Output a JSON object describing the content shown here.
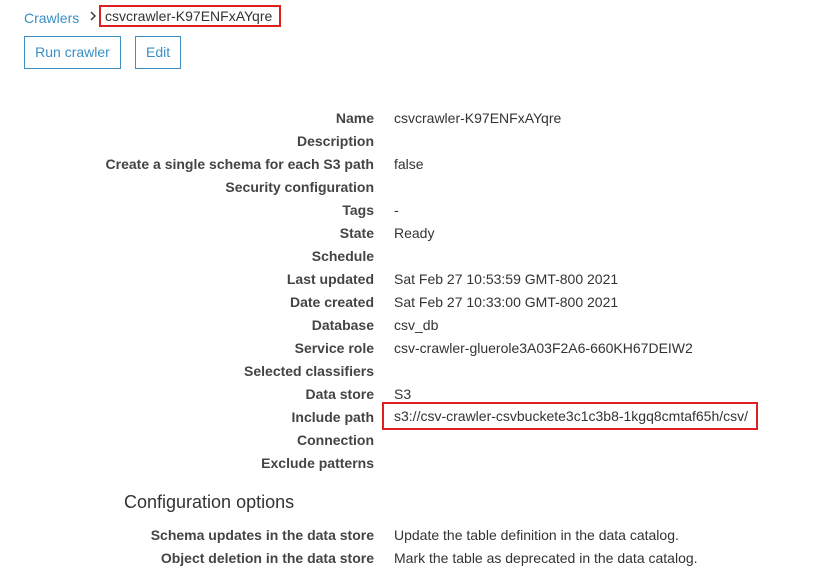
{
  "breadcrumb": {
    "parent": "Crawlers",
    "current": "csvcrawler-K97ENFxAYqre"
  },
  "actions": {
    "run_label": "Run crawler",
    "edit_label": "Edit"
  },
  "details": [
    {
      "label": "Name",
      "value": "csvcrawler-K97ENFxAYqre"
    },
    {
      "label": "Description",
      "value": ""
    },
    {
      "label": "Create a single schema for each S3 path",
      "value": "false"
    },
    {
      "label": "Security configuration",
      "value": ""
    },
    {
      "label": "Tags",
      "value": "-"
    },
    {
      "label": "State",
      "value": "Ready"
    },
    {
      "label": "Schedule",
      "value": ""
    },
    {
      "label": "Last updated",
      "value": "Sat Feb 27 10:53:59 GMT-800 2021"
    },
    {
      "label": "Date created",
      "value": "Sat Feb 27 10:33:00 GMT-800 2021"
    },
    {
      "label": "Database",
      "value": "csv_db"
    },
    {
      "label": "Service role",
      "value": "csv-crawler-gluerole3A03F2A6-660KH67DEIW2"
    },
    {
      "label": "Selected classifiers",
      "value": ""
    },
    {
      "label": "Data store",
      "value": "S3"
    },
    {
      "label": "Include path",
      "value": "s3://csv-crawler-csvbuckete3c1c3b8-1kgq8cmtaf65h/csv/"
    },
    {
      "label": "Connection",
      "value": ""
    },
    {
      "label": "Exclude patterns",
      "value": ""
    }
  ],
  "config": {
    "title": "Configuration options",
    "rows": [
      {
        "label": "Schema updates in the data store",
        "value": "Update the table definition in the data catalog."
      },
      {
        "label": "Object deletion in the data store",
        "value": "Mark the table as deprecated in the data catalog."
      }
    ]
  },
  "colors": {
    "link": "#3a8fc4",
    "highlight": "#e02020"
  }
}
